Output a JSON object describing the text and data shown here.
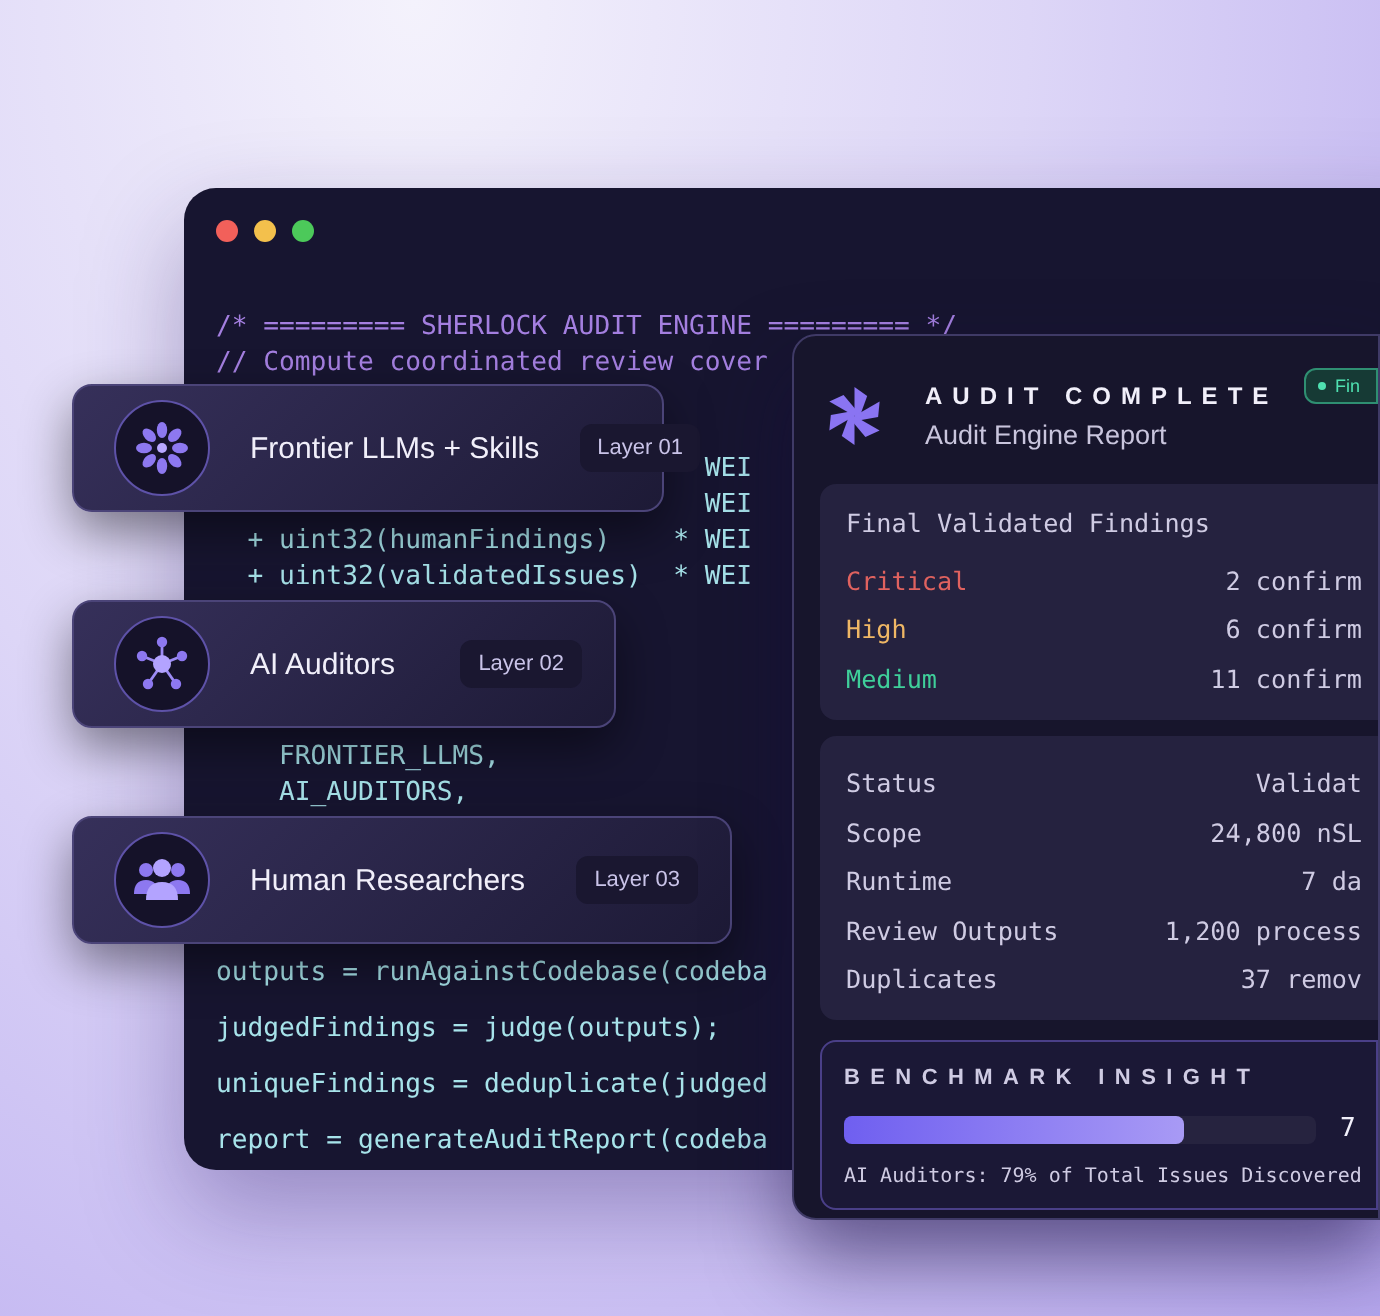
{
  "editor": {
    "code_blocks": [
      {
        "kind": "comment",
        "lines": [
          "/* ========= SHERLOCK AUDIT ENGINE ========= */",
          "// Compute coordinated review cover"
        ]
      },
      {
        "kind": "code",
        "lines": [
          "                               WEI",
          "                               WEI",
          "  + uint32(humanFindings)    * WEI",
          "  + uint32(validatedIssues)  * WEI"
        ]
      },
      {
        "kind": "code",
        "lines": [
          "    FRONTIER_LLMS,",
          "    AI_AUDITORS,"
        ]
      },
      {
        "kind": "code",
        "lines": [
          "outputs = runAgainstCodebase(codeba"
        ]
      },
      {
        "kind": "code",
        "lines": [
          "judgedFindings = judge(outputs);"
        ]
      },
      {
        "kind": "code",
        "lines": [
          "uniqueFindings = deduplicate(judged"
        ]
      },
      {
        "kind": "code",
        "lines": [
          "report = generateAuditReport(codeba"
        ]
      }
    ]
  },
  "layers": [
    {
      "kind": "models",
      "title": "Frontier LLMs + Skills",
      "badge": "Layer 01"
    },
    {
      "kind": "auditors",
      "title": "AI Auditors",
      "badge": "Layer 02"
    },
    {
      "kind": "humans",
      "title": "Human Researchers",
      "badge": "Layer 03"
    }
  ],
  "report": {
    "title": "AUDIT COMPLETE",
    "subtitle": "Audit Engine Report",
    "status_badge": "Fin",
    "findings": {
      "heading": "Final Validated Findings",
      "rows": [
        {
          "label": "Critical",
          "value": "2 confirm",
          "color": "#e0625f"
        },
        {
          "label": "High",
          "value": "6 confirm",
          "color": "#efb765"
        },
        {
          "label": "Medium",
          "value": "11 confirm",
          "color": "#3fcf9a"
        }
      ]
    },
    "stats": [
      {
        "label": "Status",
        "value": "Validat"
      },
      {
        "label": "Scope",
        "value": "24,800 nSL"
      },
      {
        "label": "Runtime",
        "value": "7 da"
      },
      {
        "label": "Review Outputs",
        "value": "1,200 process"
      },
      {
        "label": "Duplicates",
        "value": "37 remov"
      }
    ],
    "benchmark": {
      "heading": "BENCHMARK INSIGHT",
      "level": 0.72,
      "reading": "7",
      "caption": "AI Auditors: 79% of Total Issues Discovered"
    }
  }
}
